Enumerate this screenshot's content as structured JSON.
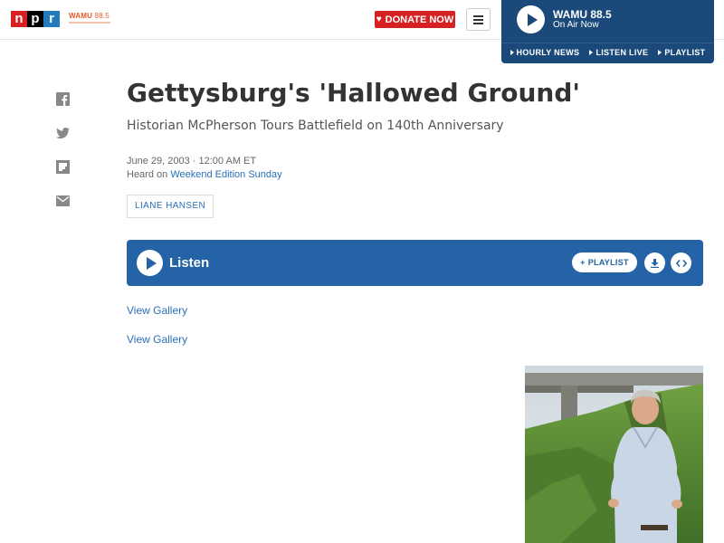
{
  "header": {
    "npr_logo": {
      "n": "n",
      "p": "p",
      "r": "r"
    },
    "wamu_logo": {
      "name": "WAMU",
      "frequency": "88.5"
    },
    "donate_label": "DONATE NOW",
    "menu_icon": "hamburger-icon"
  },
  "live": {
    "station": "WAMU 88.5",
    "status": "On Air Now",
    "links": [
      "HOURLY NEWS",
      "LISTEN LIVE",
      "PLAYLIST"
    ]
  },
  "share": {
    "icons": [
      "facebook-icon",
      "twitter-icon",
      "flipboard-icon",
      "email-icon"
    ]
  },
  "article": {
    "title": "Gettysburg's 'Hallowed Ground'",
    "subtitle": "Historian McPherson Tours Battlefield on 140th Anniversary",
    "date": "June 29, 2003 · 12:00 AM ET",
    "heard_prefix": "Heard on ",
    "heard_program": "Weekend Edition Sunday",
    "byline": "LIANE HANSEN"
  },
  "player": {
    "label": "Listen",
    "playlist_label": "PLAYLIST",
    "download_icon": "download-icon",
    "embed_icon": "embed-icon"
  },
  "gallery": {
    "links": [
      "View Gallery",
      "View Gallery"
    ]
  },
  "colors": {
    "npr_red": "#d62021",
    "npr_blue": "#237bbd",
    "live_panel": "#1b4a7a",
    "player_blue": "#2463a6",
    "link_blue": "#2870b8"
  }
}
